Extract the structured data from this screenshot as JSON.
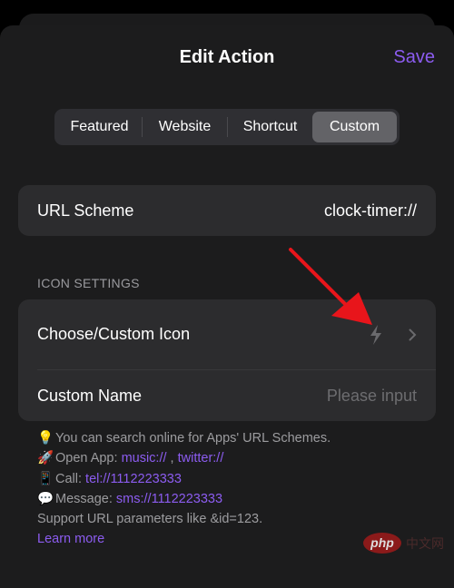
{
  "header": {
    "title": "Edit Action",
    "save_label": "Save"
  },
  "segments": [
    {
      "label": "Featured",
      "active": false
    },
    {
      "label": "Website",
      "active": false
    },
    {
      "label": "Shortcut",
      "active": false
    },
    {
      "label": "Custom",
      "active": true
    }
  ],
  "url_scheme": {
    "label": "URL Scheme",
    "value": "clock-timer://"
  },
  "icon_settings": {
    "section_label": "ICON SETTINGS",
    "choose_icon_label": "Choose/Custom Icon",
    "icon": "lightning-bolt-icon",
    "custom_name_label": "Custom Name",
    "custom_name_placeholder": "Please input"
  },
  "help": {
    "line1": {
      "emoji": "💡",
      "text": "You can search online for Apps' URL Schemes."
    },
    "line2": {
      "emoji": "🚀",
      "prefix": "Open App: ",
      "link1": "music://",
      "sep": " , ",
      "link2": "twitter://"
    },
    "line3": {
      "emoji": "📱",
      "prefix": "Call: ",
      "link": "tel://1112223333"
    },
    "line4": {
      "emoji": "💬",
      "prefix": "Message: ",
      "link": "sms://1112223333"
    },
    "line5": "Support URL parameters like &id=123.",
    "learn_more": "Learn more"
  },
  "watermark": {
    "brand": "php",
    "suffix": "中文网"
  },
  "colors": {
    "accent": "#8c5cf0",
    "annotation_arrow": "#e8151b"
  }
}
